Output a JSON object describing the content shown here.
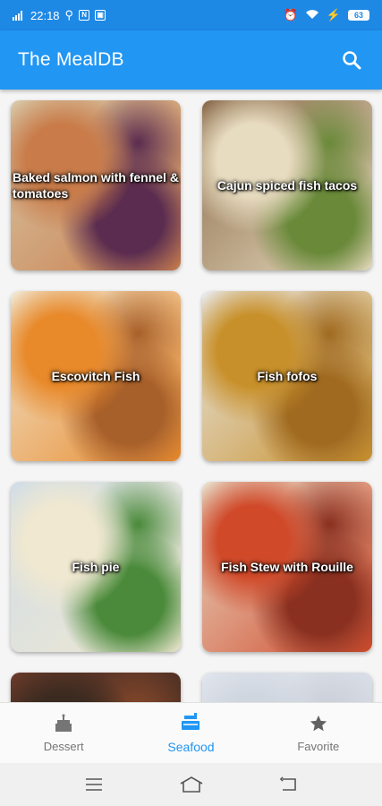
{
  "status_bar": {
    "time": "22:18",
    "battery": "63"
  },
  "app_bar": {
    "title": "The MealDB",
    "search_icon": "search-icon"
  },
  "meals": [
    {
      "name": "Baked salmon with fennel & tomatoes",
      "colors": [
        "#d8c8a8",
        "#c97c4a",
        "#5b2c4f"
      ]
    },
    {
      "name": "Cajun spiced fish tacos",
      "colors": [
        "#8a6a4a",
        "#e8dcc0",
        "#6a8a3a"
      ]
    },
    {
      "name": "Escovitch Fish",
      "colors": [
        "#f0e6d0",
        "#e8892a",
        "#a8602a"
      ]
    },
    {
      "name": "Fish fofos",
      "colors": [
        "#e8e8e8",
        "#c8902a",
        "#a06a20"
      ]
    },
    {
      "name": "Fish pie",
      "colors": [
        "#d0dde8",
        "#f0e8d0",
        "#4a8a3a"
      ]
    },
    {
      "name": "Fish Stew with Rouille",
      "colors": [
        "#e8dcc8",
        "#d04a2a",
        "#8a3020"
      ]
    },
    {
      "name": "",
      "colors": [
        "#6a3a2a",
        "#3a2a20",
        "#8a4a2a"
      ]
    },
    {
      "name": "",
      "colors": [
        "#e0e4ec",
        "#d0d6e0",
        "#c8ccd6"
      ]
    }
  ],
  "bottom_nav": [
    {
      "label": "Dessert",
      "icon": "cake-icon",
      "active": false
    },
    {
      "label": "Seafood",
      "icon": "seafood-icon",
      "active": true
    },
    {
      "label": "Favorite",
      "icon": "star-icon",
      "active": false
    }
  ],
  "system_nav": [
    "menu-icon",
    "home-icon",
    "back-icon"
  ]
}
